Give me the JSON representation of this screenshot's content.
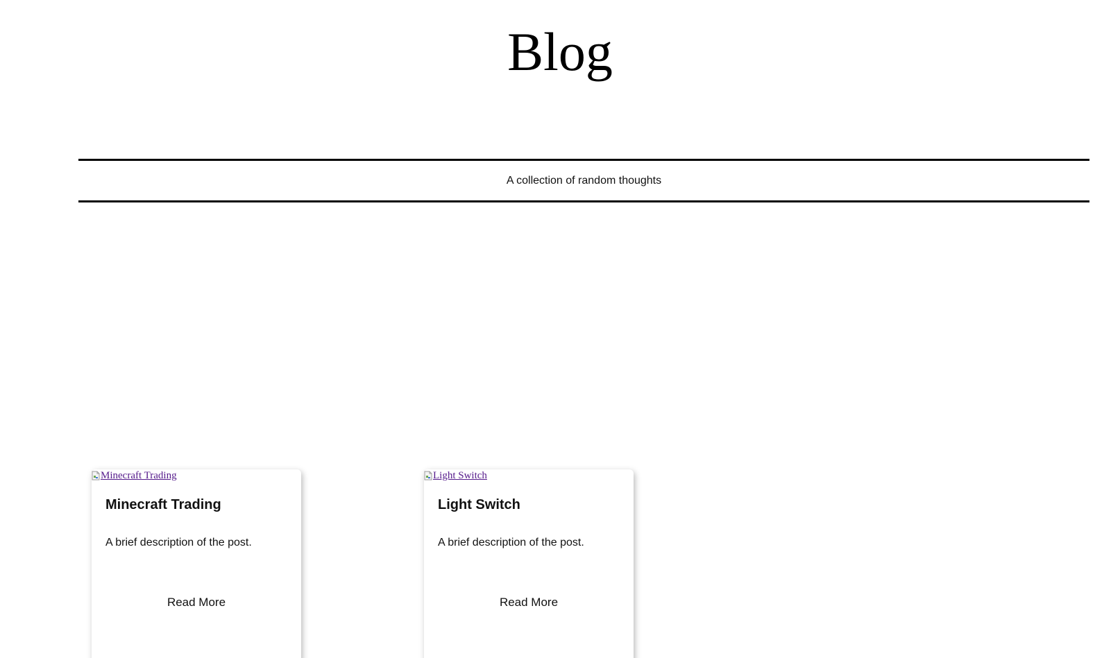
{
  "header": {
    "title": "Blog",
    "subtitle": "A collection of random thoughts"
  },
  "posts": [
    {
      "image_alt": "Minecraft Trading",
      "title": "Minecraft Trading",
      "description": "A brief description of the post.",
      "read_more_label": "Read More"
    },
    {
      "image_alt": "Light Switch",
      "title": "Light Switch",
      "description": "A brief description of the post.",
      "read_more_label": "Read More"
    }
  ],
  "colors": {
    "link_visited": "#551a8b",
    "text": "#111111",
    "rule": "#000000",
    "background": "#ffffff"
  },
  "icons": {
    "card_image": "broken-image-icon"
  }
}
